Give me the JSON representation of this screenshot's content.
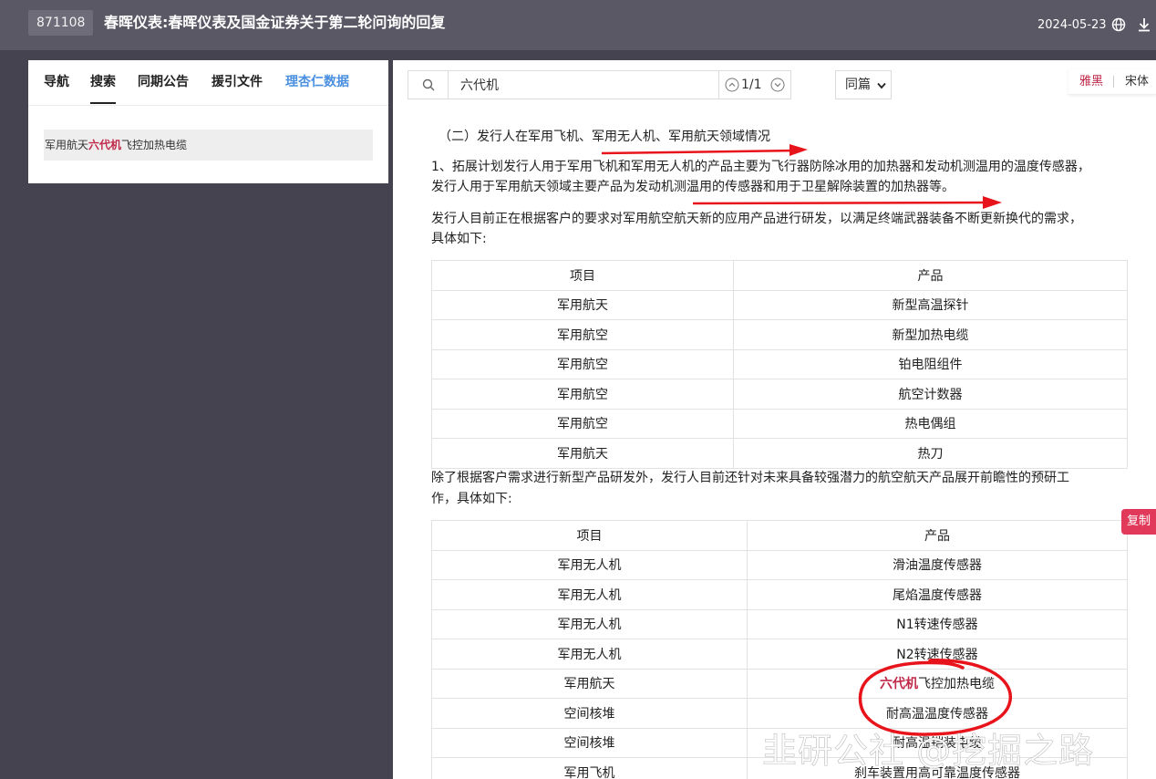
{
  "header": {
    "code": "871108",
    "title": "春晖仪表:春晖仪表及国金证券关于第二轮问询的回复",
    "date": "2024-05-23",
    "icons": [
      "globe-icon",
      "download-icon"
    ]
  },
  "left_panel": {
    "tabs": [
      {
        "label": "导航",
        "active": false
      },
      {
        "label": "搜索",
        "active": true
      },
      {
        "label": "同期公告",
        "active": false
      },
      {
        "label": "援引文件",
        "active": false
      },
      {
        "label": "理杏仁数据",
        "active": false
      }
    ],
    "results": [
      {
        "before": "军用航天",
        "highlight": "六代机",
        "after": "飞控加热电缆"
      }
    ]
  },
  "search": {
    "query": "六代机",
    "count": "1/1",
    "scope": "同篇"
  },
  "font_switch": {
    "active": "雅黑",
    "other": "宋体"
  },
  "document": {
    "section_title": "（二）发行人在军用飞机、军用无人机、军用航天领域情况",
    "para1_line1": "1、拓展计划发行人用于军用飞机和军用无人机的产品主要为飞行器防除冰用的加热器和发动机测温用的温度传感器，",
    "para1_line2": "发行人用于军用航天领域主要产品为发动机测温用的传感器和用于卫星解除装置的加热器等。",
    "para2_line1": "发行人目前正在根据客户的要求对军用航空航天新的应用产品进行研发，以满足终端武器装备不断更新换代的需求，",
    "para2_line2": "具体如下:",
    "table1": {
      "headers": [
        "项目",
        "产品"
      ],
      "rows": [
        [
          "军用航天",
          "新型高温探针"
        ],
        [
          "军用航空",
          "新型加热电缆"
        ],
        [
          "军用航空",
          "铂电阻组件"
        ],
        [
          "军用航空",
          "航空计数器"
        ],
        [
          "军用航空",
          "热电偶组"
        ],
        [
          "军用航天",
          "热刀"
        ]
      ]
    },
    "para3_line1": "除了根据客户需求进行新型产品研发外，发行人目前还针对未来具备较强潜力的航空航天产品展开前瞻性的预研工",
    "para3_line2": "作，具体如下:",
    "table2": {
      "headers": [
        "项目",
        "产品"
      ],
      "rows": [
        [
          "军用无人机",
          "滑油温度传感器"
        ],
        [
          "军用无人机",
          "尾焰温度传感器"
        ],
        [
          "军用无人机",
          "N1转速传感器"
        ],
        [
          "军用无人机",
          "N2转速传感器"
        ],
        [
          "军用航天",
          "六代机飞控加热电缆"
        ],
        [
          "空间核堆",
          "耐高温温度传感器"
        ],
        [
          "空间核堆",
          "耐高温铠装电缆"
        ],
        [
          "军用飞机",
          "刹车装置用高可靠温度传感器"
        ]
      ],
      "highlight_row": {
        "highlight": "六代机",
        "after": "飞控加热电缆"
      }
    }
  },
  "copy_button": "复制",
  "watermark": "韭研公社 @挖掘之路",
  "colors": {
    "topbar": "#595864",
    "background": "#44434f",
    "highlight": "#c0284a",
    "link_blue": "#4a8fe0",
    "annotation_red": "#e8141b"
  }
}
